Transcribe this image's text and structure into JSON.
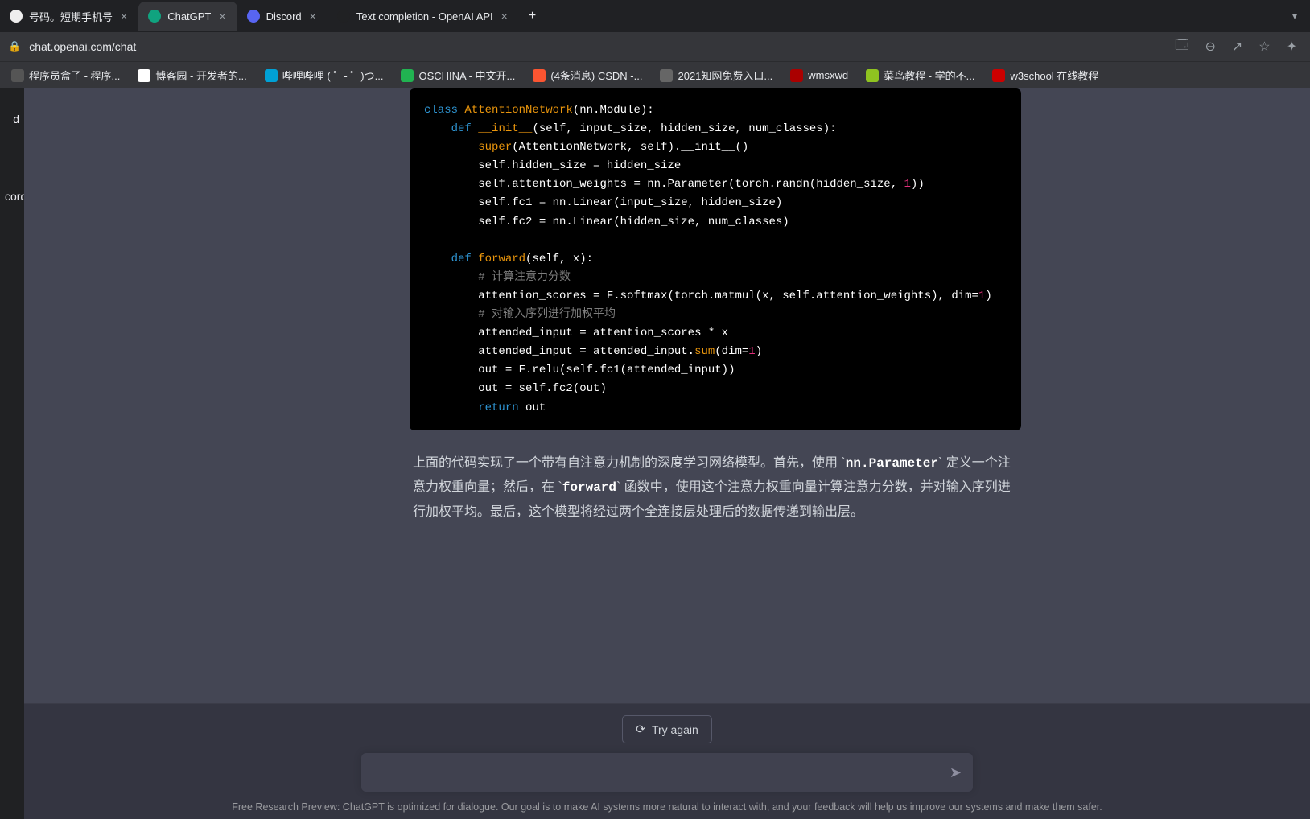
{
  "browser": {
    "tabs": [
      {
        "label": "号码。短期手机号",
        "active": false
      },
      {
        "label": "ChatGPT",
        "active": true
      },
      {
        "label": "Discord",
        "active": false
      },
      {
        "label": "Text completion - OpenAI API",
        "active": false
      }
    ],
    "new_tab": "+",
    "overflow": "▾",
    "url": "chat.openai.com/chat",
    "addr_icons": {
      "translate": "🗔",
      "zoom": "⊖",
      "share": "↗",
      "star": "☆",
      "ext": "✦"
    }
  },
  "bookmarks": [
    {
      "label": "程序员盒子 - 程序..."
    },
    {
      "label": "博客园 - 开发者的..."
    },
    {
      "label": "哔哩哔哩 ( ゜- ゜)つ..."
    },
    {
      "label": "OSCHINA - 中文开..."
    },
    {
      "label": "(4条消息) CSDN -..."
    },
    {
      "label": "2021知网免费入口..."
    },
    {
      "label": "wmsxwd"
    },
    {
      "label": "菜鸟教程 - 学的不..."
    },
    {
      "label": "w3school 在线教程"
    }
  ],
  "sidebar": {
    "item1": "d",
    "item2": "cord"
  },
  "code": {
    "l1a": "class",
    "l1b": "AttentionNetwork",
    "l1c": "(nn.Module):",
    "l2a": "def",
    "l2b": "__init__",
    "l2c": "(self, input_size, hidden_size, num_classes):",
    "l3a": "super",
    "l3b": "(AttentionNetwork, self).__init__()",
    "l4": "self.hidden_size = hidden_size",
    "l5a": "self.attention_weights = nn.Parameter(torch.randn(hidden_size, ",
    "l5b": "1",
    "l5c": "))",
    "l6": "self.fc1 = nn.Linear(input_size, hidden_size)",
    "l7": "self.fc2 = nn.Linear(hidden_size, num_classes)",
    "l8a": "def",
    "l8b": "forward",
    "l8c": "(self, x):",
    "l9": "# 计算注意力分数",
    "l10a": "attention_scores = F.softmax(torch.matmul(x, self.attention_weights), dim=",
    "l10b": "1",
    "l10c": ")",
    "l11": "# 对输入序列进行加权平均",
    "l12": "attended_input = attention_scores * x",
    "l13a": "attended_input = attended_input.",
    "l13b": "sum",
    "l13c": "(dim=",
    "l13d": "1",
    "l13e": ")",
    "l14": "out = F.relu(self.fc1(attended_input))",
    "l15": "out = self.fc2(out)",
    "l16a": "return",
    "l16b": " out"
  },
  "explain": {
    "p1a": "上面的代码实现了一个带有自注意力机制的深度学习网络模型。首先，使用 `",
    "p1b": "nn.Parameter",
    "p1c": "` 定义一个注意力权重向量；然后，在 `",
    "p1d": "forward",
    "p1e": "` 函数中，使用这个注意力权重向量计算注意力分数，并对输入序列进行加权平均。最后，这个模型将经过两个全连接层处理后的数据传递到输出层。"
  },
  "bottom": {
    "try_again": "Try again",
    "input_placeholder": "",
    "disclaimer": "Free Research Preview: ChatGPT is optimized for dialogue. Our goal is to make AI systems more natural to interact with, and your feedback will help us improve our systems and make them safer."
  }
}
